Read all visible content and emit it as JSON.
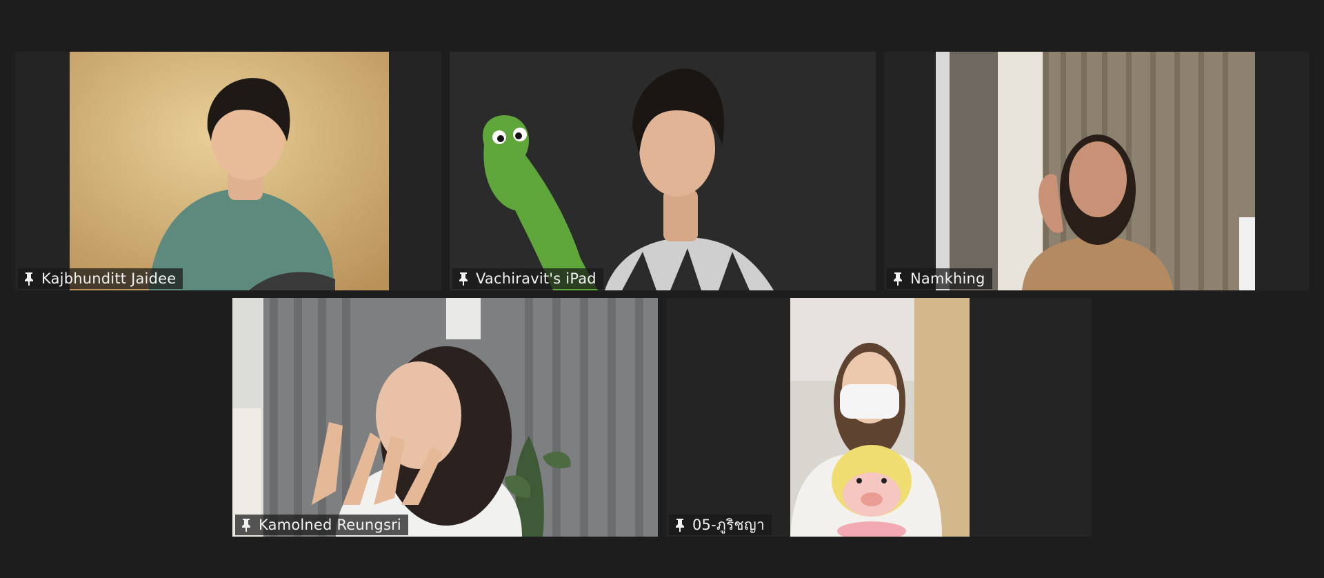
{
  "app": {
    "view": "gallery"
  },
  "participants": [
    {
      "name": "Kajbhunditt Jaidee",
      "icon": "pin-icon"
    },
    {
      "name": "Vachiravit's iPad",
      "icon": "pin-icon"
    },
    {
      "name": "Namkhing",
      "icon": "pin-icon"
    },
    {
      "name": "Kamolned Reungsri",
      "icon": "pin-icon"
    },
    {
      "name": "05-ภูริชญา",
      "icon": "pin-icon"
    }
  ],
  "colors": {
    "background": "#1d1d1d",
    "tile": "#242424",
    "name_text": "#f2f2f2"
  }
}
